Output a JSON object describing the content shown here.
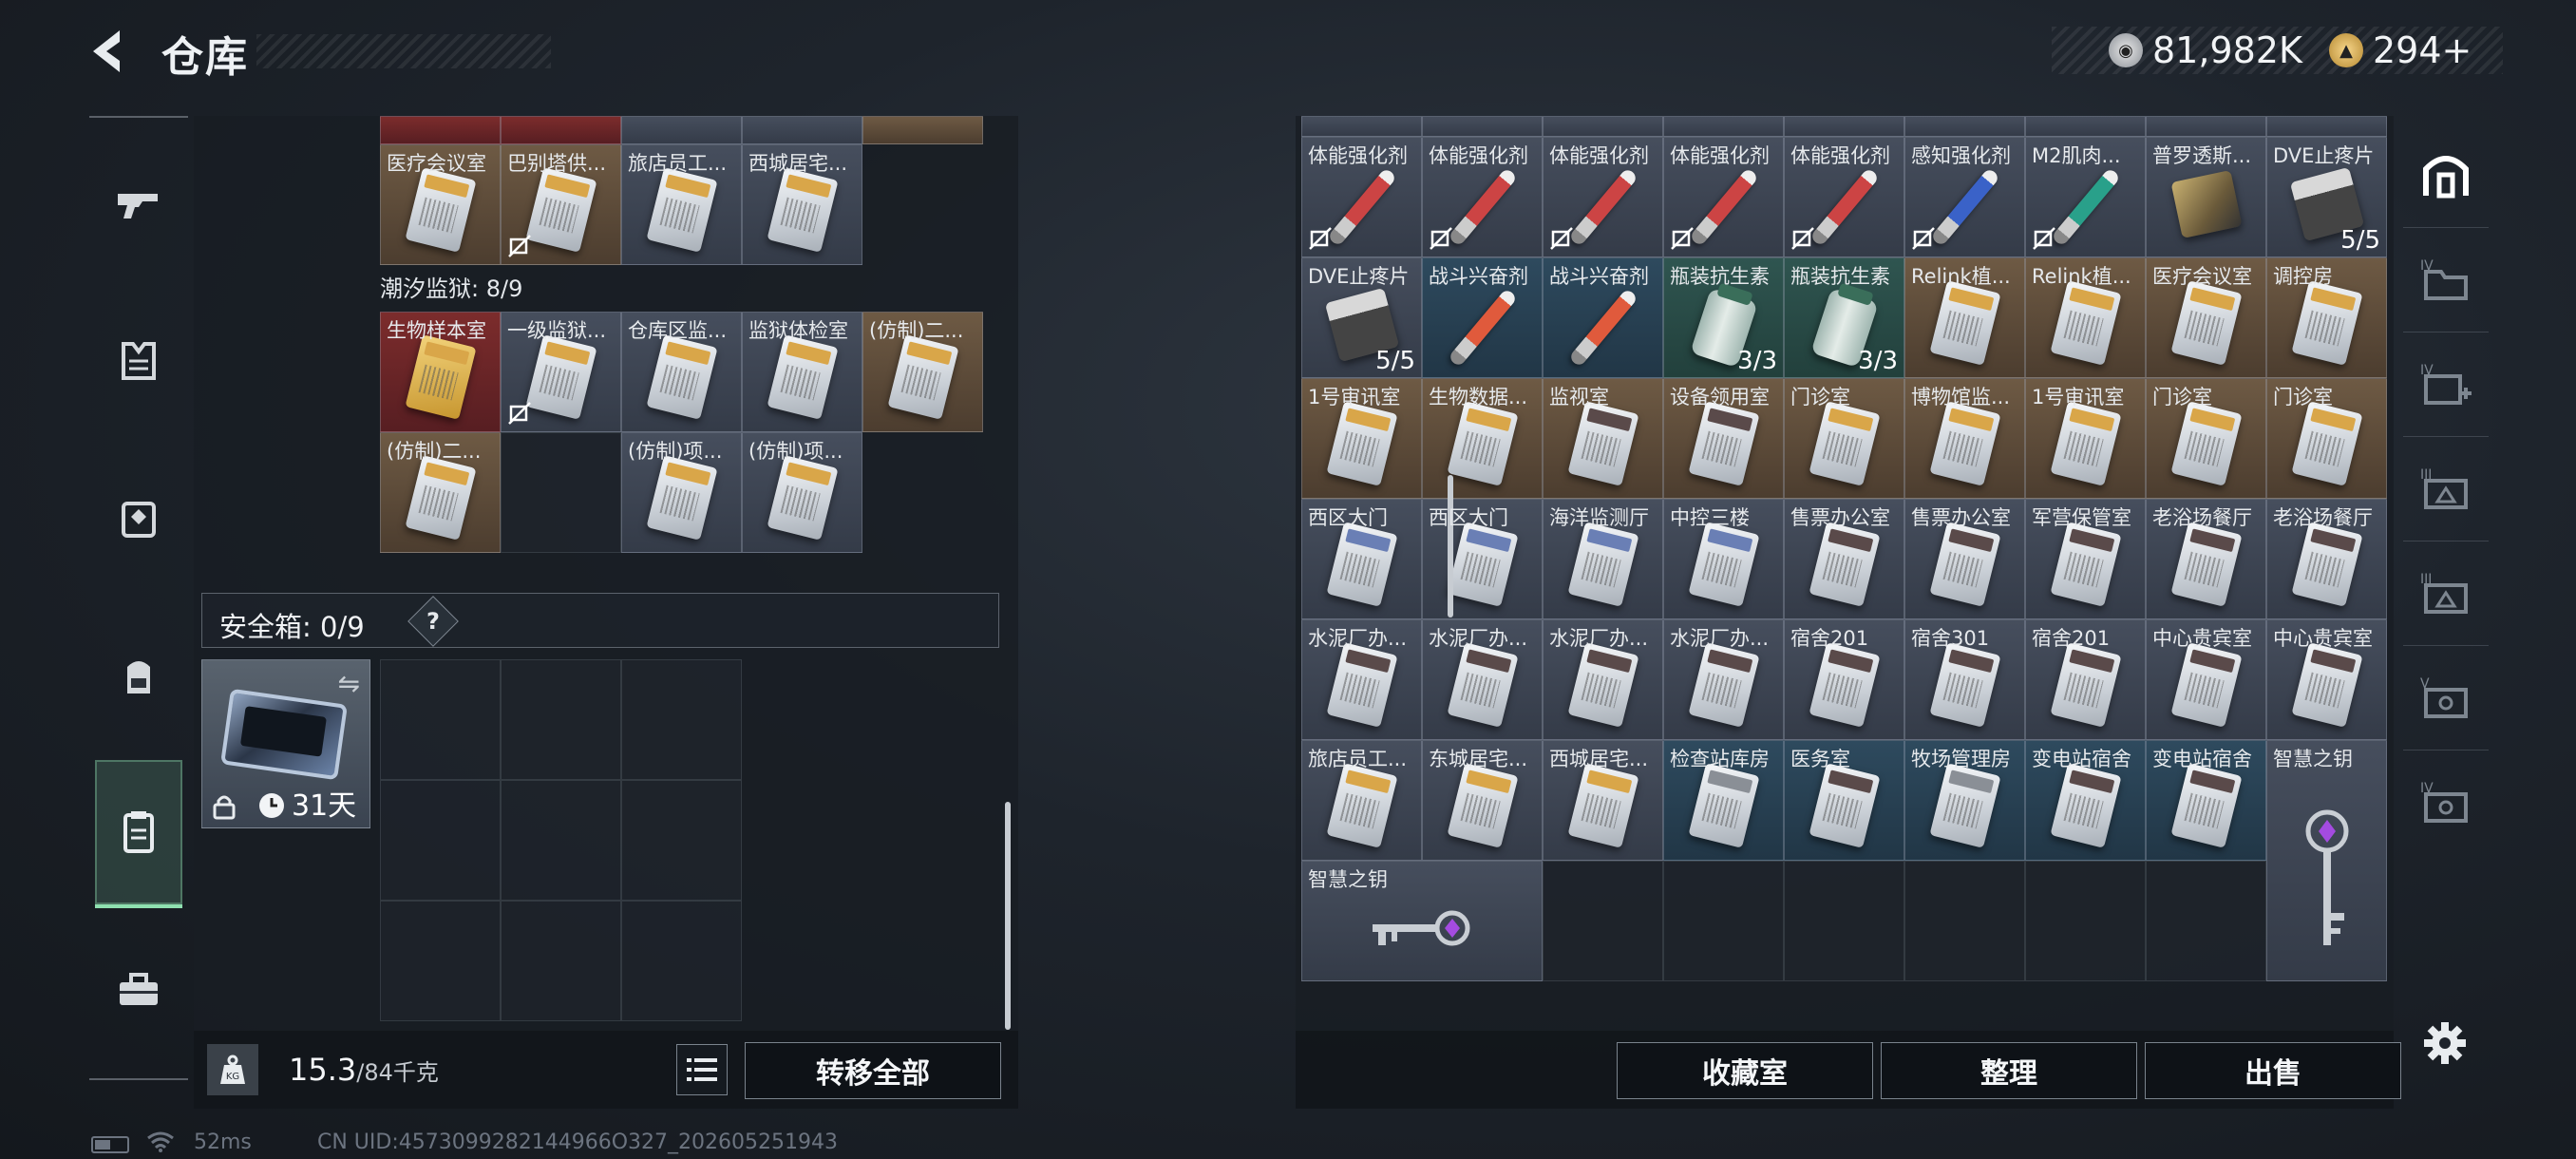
{
  "header": {
    "title": "仓库",
    "currency": [
      {
        "icon": "silver-coin-icon",
        "value": "81,982K"
      },
      {
        "icon": "gold-triangle-coin-icon",
        "value": "294+"
      }
    ]
  },
  "left_nav": [
    {
      "icon": "gun-icon"
    },
    {
      "icon": "armor-vest-icon"
    },
    {
      "icon": "chest-rig-icon"
    },
    {
      "icon": "backpack-icon"
    },
    {
      "icon": "safe-box-icon",
      "active": true
    },
    {
      "icon": "toolbox-icon"
    }
  ],
  "left_panel": {
    "top_items": [
      {
        "label": "医疗会议室",
        "bg": "brown",
        "art": "card",
        "nosell": false
      },
      {
        "label": "巴别塔供...",
        "bg": "brown",
        "art": "card",
        "nosell": true
      },
      {
        "label": "旅店员工...",
        "bg": "gray",
        "art": "card",
        "nosell": false
      },
      {
        "label": "西城居宅...",
        "bg": "gray",
        "art": "card",
        "nosell": false
      }
    ],
    "section_label": "潮汐监狱: 8/9",
    "prison_items": [
      {
        "label": "生物样本室",
        "bg": "red",
        "art": "card-gold",
        "nosell": false
      },
      {
        "label": "一级监狱...",
        "bg": "gray",
        "art": "card",
        "nosell": true
      },
      {
        "label": "仓库区监...",
        "bg": "gray",
        "art": "card",
        "nosell": false
      },
      {
        "label": "监狱体检室",
        "bg": "gray",
        "art": "card",
        "nosell": false
      },
      {
        "label": "(仿制)二...",
        "bg": "brown",
        "art": "card",
        "nosell": false
      },
      {
        "label": "(仿制)二...",
        "bg": "brown",
        "art": "card",
        "nosell": false
      },
      {
        "label": "",
        "bg": "none",
        "art": "",
        "nosell": false
      },
      {
        "label": "(仿制)项...",
        "bg": "gray",
        "art": "card",
        "nosell": false
      },
      {
        "label": "(仿制)项...",
        "bg": "gray",
        "art": "card",
        "nosell": false
      }
    ],
    "safe": {
      "label": "安全箱: 0/9",
      "help": "?",
      "days": "31天"
    },
    "weight": {
      "current": "15.3",
      "capacity": "/84千克"
    },
    "transfer_all": "转移全部"
  },
  "right_panel": {
    "items": [
      {
        "label": "体能强化剂",
        "bg": "gray",
        "art": "syringe",
        "count": "",
        "nosell": true
      },
      {
        "label": "体能强化剂",
        "bg": "gray",
        "art": "syringe",
        "count": "",
        "nosell": true
      },
      {
        "label": "体能强化剂",
        "bg": "gray",
        "art": "syringe",
        "count": "",
        "nosell": true
      },
      {
        "label": "体能强化剂",
        "bg": "gray",
        "art": "syringe",
        "count": "",
        "nosell": true
      },
      {
        "label": "体能强化剂",
        "bg": "gray",
        "art": "syringe",
        "count": "",
        "nosell": true
      },
      {
        "label": "感知强化剂",
        "bg": "gray",
        "art": "syringe-blue",
        "count": "",
        "nosell": true
      },
      {
        "label": "M2肌肉...",
        "bg": "gray",
        "art": "syringe-teal",
        "count": "",
        "nosell": true
      },
      {
        "label": "普罗透斯...",
        "bg": "gray",
        "art": "device",
        "count": "",
        "nosell": false
      },
      {
        "label": "DVE止疼片",
        "bg": "gray",
        "art": "pills",
        "count": "5/5",
        "nosell": false
      },
      {
        "label": "DVE止疼片",
        "bg": "gray",
        "art": "pills",
        "count": "5/5",
        "nosell": false
      },
      {
        "label": "战斗兴奋剂",
        "bg": "blue",
        "art": "syringe-red",
        "count": "",
        "nosell": false
      },
      {
        "label": "战斗兴奋剂",
        "bg": "blue",
        "art": "syringe-red",
        "count": "",
        "nosell": false
      },
      {
        "label": "瓶装抗生素",
        "bg": "teal",
        "art": "bottle",
        "count": "3/3",
        "nosell": false
      },
      {
        "label": "瓶装抗生素",
        "bg": "teal",
        "art": "bottle",
        "count": "3/3",
        "nosell": false
      },
      {
        "label": "Relink植...",
        "bg": "brown",
        "art": "card",
        "count": "",
        "nosell": false
      },
      {
        "label": "Relink植...",
        "bg": "brown",
        "art": "card",
        "count": "",
        "nosell": false
      },
      {
        "label": "医疗会议室",
        "bg": "brown",
        "art": "card",
        "count": "",
        "nosell": false
      },
      {
        "label": "调控房",
        "bg": "brown",
        "art": "card",
        "count": "",
        "nosell": false
      },
      {
        "label": "1号审讯室",
        "bg": "brown",
        "art": "card",
        "count": "",
        "nosell": false
      },
      {
        "label": "生物数据...",
        "bg": "brown",
        "art": "card",
        "count": "",
        "nosell": false
      },
      {
        "label": "监视室",
        "bg": "brown",
        "art": "card-dark",
        "count": "",
        "nosell": false
      },
      {
        "label": "设备领用室",
        "bg": "brown",
        "art": "card-dark",
        "count": "",
        "nosell": false
      },
      {
        "label": "门诊室",
        "bg": "brown",
        "art": "card",
        "count": "",
        "nosell": false
      },
      {
        "label": "博物馆监...",
        "bg": "brown",
        "art": "card",
        "count": "",
        "nosell": false
      },
      {
        "label": "1号审讯室",
        "bg": "brown",
        "art": "card",
        "count": "",
        "nosell": false
      },
      {
        "label": "门诊室",
        "bg": "brown",
        "art": "card",
        "count": "",
        "nosell": false
      },
      {
        "label": "门诊室",
        "bg": "brown",
        "art": "card",
        "count": "",
        "nosell": false
      },
      {
        "label": "西区大门",
        "bg": "gray",
        "art": "card-blue",
        "count": "",
        "nosell": false
      },
      {
        "label": "西区大门",
        "bg": "gray",
        "art": "card-blue",
        "count": "",
        "nosell": false
      },
      {
        "label": "海洋监测厅",
        "bg": "gray",
        "art": "card-blue",
        "count": "",
        "nosell": false
      },
      {
        "label": "中控三楼",
        "bg": "gray",
        "art": "card-blue",
        "count": "",
        "nosell": false
      },
      {
        "label": "售票办公室",
        "bg": "gray",
        "art": "card-dark",
        "count": "",
        "nosell": false
      },
      {
        "label": "售票办公室",
        "bg": "gray",
        "art": "card-dark",
        "count": "",
        "nosell": false
      },
      {
        "label": "军营保管室",
        "bg": "gray",
        "art": "card-dark",
        "count": "",
        "nosell": false
      },
      {
        "label": "老浴场餐厅",
        "bg": "gray",
        "art": "card-dark",
        "count": "",
        "nosell": false
      },
      {
        "label": "老浴场餐厅",
        "bg": "gray",
        "art": "card-dark",
        "count": "",
        "nosell": false
      },
      {
        "label": "水泥厂办...",
        "bg": "gray",
        "art": "card-dark",
        "count": "",
        "nosell": false
      },
      {
        "label": "水泥厂办...",
        "bg": "gray",
        "art": "card-dark",
        "count": "",
        "nosell": false
      },
      {
        "label": "水泥厂办...",
        "bg": "gray",
        "art": "card-dark",
        "count": "",
        "nosell": false
      },
      {
        "label": "水泥厂办...",
        "bg": "gray",
        "art": "card-dark",
        "count": "",
        "nosell": false
      },
      {
        "label": "宿舍201",
        "bg": "gray",
        "art": "card-dark",
        "count": "",
        "nosell": false
      },
      {
        "label": "宿舍301",
        "bg": "gray",
        "art": "card-dark",
        "count": "",
        "nosell": false
      },
      {
        "label": "宿舍201",
        "bg": "gray",
        "art": "card-dark",
        "count": "",
        "nosell": false
      },
      {
        "label": "中心贵宾室",
        "bg": "gray",
        "art": "card-dark",
        "count": "",
        "nosell": false
      },
      {
        "label": "中心贵宾室",
        "bg": "gray",
        "art": "card-dark",
        "count": "",
        "nosell": false
      },
      {
        "label": "旅店员工...",
        "bg": "gray",
        "art": "card",
        "count": "",
        "nosell": false
      },
      {
        "label": "东城居宅...",
        "bg": "gray",
        "art": "card",
        "count": "",
        "nosell": false
      },
      {
        "label": "西城居宅...",
        "bg": "gray",
        "art": "card",
        "count": "",
        "nosell": false
      },
      {
        "label": "检查站库房",
        "bg": "blue",
        "art": "card-gray",
        "count": "",
        "nosell": false
      },
      {
        "label": "医务室",
        "bg": "blue",
        "art": "card-dark",
        "count": "",
        "nosell": false
      },
      {
        "label": "牧场管理房",
        "bg": "blue",
        "art": "card-gray",
        "count": "",
        "nosell": false
      },
      {
        "label": "变电站宿舍",
        "bg": "blue",
        "art": "card-dark",
        "count": "",
        "nosell": false
      },
      {
        "label": "变电站宿舍",
        "bg": "blue",
        "art": "card-dark",
        "count": "",
        "nosell": false
      }
    ],
    "key_vertical_label": "智慧之钥",
    "key_horizontal_label": "智慧之钥",
    "buttons": {
      "collection": "收藏室",
      "sort": "整理",
      "sell": "出售"
    }
  },
  "right_nav": [
    {
      "icon": "stash-home-icon"
    },
    {
      "icon": "folder-tier4-icon"
    },
    {
      "icon": "medkit-tier4-icon"
    },
    {
      "icon": "keycard-tier3-icon"
    },
    {
      "icon": "keycard-tier3b-icon"
    },
    {
      "icon": "case-tier5-icon"
    },
    {
      "icon": "case-tier4-icon"
    }
  ],
  "footer": {
    "ping": "52ms",
    "uid": "CN UID:4573099282144966O327_202605251943"
  },
  "colors": {
    "accent_active": "#8fe0b0",
    "panel_bg": "#181d23",
    "cell_brown": "#6e5a44",
    "cell_red": "#7c2c2c",
    "cell_blue": "#2e4a5e",
    "cell_teal": "#2f5550"
  }
}
